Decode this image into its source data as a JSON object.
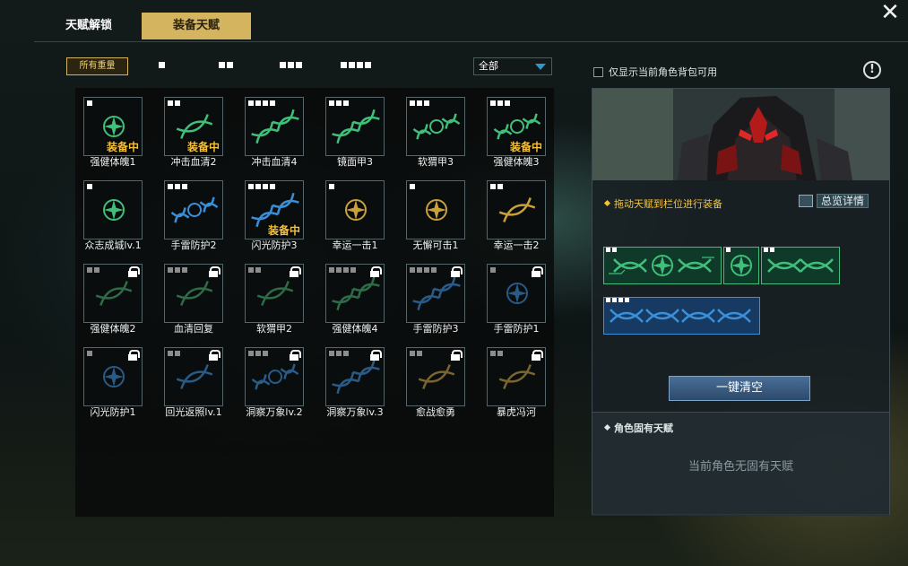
{
  "tabs": [
    {
      "label": "天赋解锁",
      "active": false
    },
    {
      "label": "装备天赋",
      "active": true
    }
  ],
  "filters": {
    "all_label": "所有重量",
    "weights": [
      1,
      2,
      3,
      4
    ],
    "dropdown_value": "全部"
  },
  "equipped_label": "装备中",
  "talents": [
    {
      "name": "强健体魄1",
      "weight": 1,
      "icon": "emblem-icon",
      "color": "#3fbf7a",
      "equipped": true,
      "locked": false
    },
    {
      "name": "冲击血清2",
      "weight": 2,
      "icon": "dna-icon",
      "color": "#3fbf7a",
      "equipped": true,
      "locked": false
    },
    {
      "name": "冲击血清4",
      "weight": 4,
      "icon": "dna-long-icon",
      "color": "#3fbf7a",
      "equipped": false,
      "locked": false
    },
    {
      "name": "镜面甲3",
      "weight": 3,
      "icon": "dna-long-icon",
      "color": "#3fbf7a",
      "equipped": false,
      "locked": false
    },
    {
      "name": "软猬甲3",
      "weight": 3,
      "icon": "dna-emblem-icon",
      "color": "#3fbf7a",
      "equipped": false,
      "locked": false
    },
    {
      "name": "强健体魄3",
      "weight": 3,
      "icon": "dna-emblem-icon",
      "color": "#3fbf7a",
      "equipped": true,
      "locked": false
    },
    {
      "name": "众志成城lv.1",
      "weight": 1,
      "icon": "emblem-icon",
      "color": "#3fbf7a",
      "equipped": false,
      "locked": false
    },
    {
      "name": "手雷防护2",
      "weight": 3,
      "icon": "dna-emblem-icon",
      "color": "#3a8fd9",
      "equipped": false,
      "locked": false
    },
    {
      "name": "闪光防护3",
      "weight": 4,
      "icon": "dna-long-icon",
      "color": "#3a8fd9",
      "equipped": true,
      "locked": false
    },
    {
      "name": "幸运一击1",
      "weight": 1,
      "icon": "emblem-icon",
      "color": "#c9a13c",
      "equipped": false,
      "locked": false
    },
    {
      "name": "无懈可击1",
      "weight": 1,
      "icon": "emblem-icon",
      "color": "#c9a13c",
      "equipped": false,
      "locked": false
    },
    {
      "name": "幸运一击2",
      "weight": 2,
      "icon": "dna-icon",
      "color": "#c9a13c",
      "equipped": false,
      "locked": false
    },
    {
      "name": "强健体魄2",
      "weight": 2,
      "icon": "dna-icon",
      "color": "#2e6b48",
      "equipped": false,
      "locked": true
    },
    {
      "name": "血清回复",
      "weight": 3,
      "icon": "dna-icon",
      "color": "#2e6b48",
      "equipped": false,
      "locked": true
    },
    {
      "name": "软猬甲2",
      "weight": 2,
      "icon": "dna-icon",
      "color": "#2e6b48",
      "equipped": false,
      "locked": true
    },
    {
      "name": "强健体魄4",
      "weight": 4,
      "icon": "dna-long-icon",
      "color": "#2e6b48",
      "equipped": false,
      "locked": true
    },
    {
      "name": "手雷防护3",
      "weight": 4,
      "icon": "dna-long-icon",
      "color": "#2a5a86",
      "equipped": false,
      "locked": true
    },
    {
      "name": "手雷防护1",
      "weight": 1,
      "icon": "emblem-icon",
      "color": "#2a5a86",
      "equipped": false,
      "locked": true
    },
    {
      "name": "闪光防护1",
      "weight": 1,
      "icon": "emblem-icon",
      "color": "#2a5a86",
      "equipped": false,
      "locked": true
    },
    {
      "name": "回光返照lv.1",
      "weight": 2,
      "icon": "dna-icon",
      "color": "#2a5a86",
      "equipped": false,
      "locked": true
    },
    {
      "name": "洞察万象lv.2",
      "weight": 3,
      "icon": "dna-emblem-icon",
      "color": "#2a5a86",
      "equipped": false,
      "locked": true
    },
    {
      "name": "洞察万象lv.3",
      "weight": 3,
      "icon": "dna-long-icon",
      "color": "#2a5a86",
      "equipped": false,
      "locked": true
    },
    {
      "name": "愈战愈勇",
      "weight": 2,
      "icon": "dna-icon",
      "color": "#7a6530",
      "equipped": false,
      "locked": true
    },
    {
      "name": "暴虎冯河",
      "weight": 2,
      "icon": "dna-icon",
      "color": "#7a6530",
      "equipped": false,
      "locked": true
    }
  ],
  "right_panel": {
    "checkbox_label": "仅显示当前角色背包可用",
    "info_icon": "!",
    "drag_hint": "拖动天赋到栏位进行装备",
    "overview_label": "总览详情",
    "equipped_slots": [
      {
        "weight": 2,
        "color": "#3fbf7a",
        "icon": "dna-emblem-icon"
      },
      {
        "weight": 1,
        "color": "#3fbf7a",
        "icon": "emblem-icon"
      },
      {
        "weight": 2,
        "color": "#3fbf7a",
        "icon": "dna-icon"
      },
      {
        "weight": 4,
        "color": "#3a8fd9",
        "icon": "dna-long-icon"
      }
    ],
    "clear_label": "一键清空",
    "innate_title": "角色固有天赋",
    "innate_empty": "当前角色无固有天赋"
  }
}
